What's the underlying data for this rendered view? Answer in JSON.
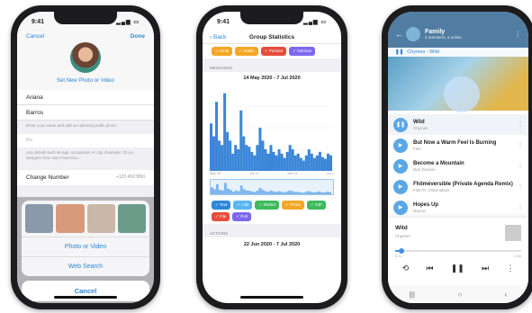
{
  "colors": {
    "accent": "#2d87d8",
    "header": "#517da2",
    "chart": "#3b86d8"
  },
  "phone1": {
    "time": "9:41",
    "cancel": "Cancel",
    "done": "Done",
    "set_photo": "Set New Photo or Video",
    "first_name": "Ariana",
    "last_name": "Barros",
    "name_hint": "Enter your name and add an optional profile photo.",
    "bio_placeholder": "Bio",
    "bio_hint": "Any details such as age, occupation or city. Example: 23 y.o. designer from San Francisco.",
    "change_number": "Change Number",
    "phone_value": "+123 4567890",
    "photo_or_video": "Photo or Video",
    "web_search": "Web Search",
    "sheet_cancel": "Cancel"
  },
  "phone2": {
    "time": "9:41",
    "back": "Back",
    "title": "Group Statistics",
    "top_chips": [
      {
        "label": "✓ Hindi",
        "color": "#f5a623"
      },
      {
        "label": "✓ Arabic",
        "color": "#f5a623"
      },
      {
        "label": "✓ Persian",
        "color": "#e74c3c"
      },
      {
        "label": "✓ German",
        "color": "#7b68ee"
      }
    ],
    "messages_header": "MESSAGES",
    "range": "14 May 2020 - 7 Jul 2020",
    "x_labels": [
      "Mar 30",
      "Jun 6",
      "Jun 21",
      "Jul 1"
    ],
    "bottom_chips": [
      {
        "label": "✓ Text",
        "color": "#2d87d8"
      },
      {
        "label": "✓ Link",
        "color": "#56b6f0"
      },
      {
        "label": "✓ Sticker",
        "color": "#3dba5b"
      },
      {
        "label": "✓ Photo",
        "color": "#f5a623"
      },
      {
        "label": "✓ GIF",
        "color": "#3dba5b"
      },
      {
        "label": "✓ File",
        "color": "#e74c3c"
      },
      {
        "label": "✓ Poll",
        "color": "#7b68ee"
      }
    ],
    "actions_header": "ACTIONS",
    "range2": "22 Jun 2020 - 7 Jul 2020"
  },
  "chart_data": {
    "type": "area",
    "title": "MESSAGES",
    "subtitle": "14 May 2020 - 7 Jul 2020",
    "xlabel": "",
    "ylabel": "",
    "x_ticks": [
      "Mar 30",
      "Jun 6",
      "Jun 21",
      "Jul 1"
    ],
    "values": [
      55,
      40,
      80,
      35,
      30,
      90,
      45,
      35,
      20,
      30,
      25,
      70,
      40,
      30,
      28,
      22,
      18,
      30,
      50,
      35,
      25,
      20,
      30,
      22,
      18,
      25,
      20,
      15,
      22,
      30,
      25,
      18,
      20,
      15,
      12,
      18,
      25,
      20,
      15,
      18,
      22,
      16,
      14,
      20,
      18
    ],
    "ylim": [
      0,
      100
    ],
    "grid": true
  },
  "phone3": {
    "title": "Family",
    "subtitle": "4 members, 2 online",
    "now_playing_bar": "Chymes - Wild",
    "tracks": [
      {
        "name": "Wild",
        "artist": "Chymes"
      },
      {
        "name": "But Now a Warm Feel Is Burning",
        "artist": "Flint"
      },
      {
        "name": "Become a Mountain",
        "artist": "Dan Dosson"
      },
      {
        "name": "Fhilméversible (Private Agenda Remix)",
        "artist": "Flint Ft. Chloé Black"
      },
      {
        "name": "Hopes Up",
        "artist": "Drama"
      }
    ],
    "np_name": "Wild",
    "np_artist": "Chymes",
    "progress": 0.05,
    "time_elapsed": "0:11",
    "time_total": "2:56"
  }
}
